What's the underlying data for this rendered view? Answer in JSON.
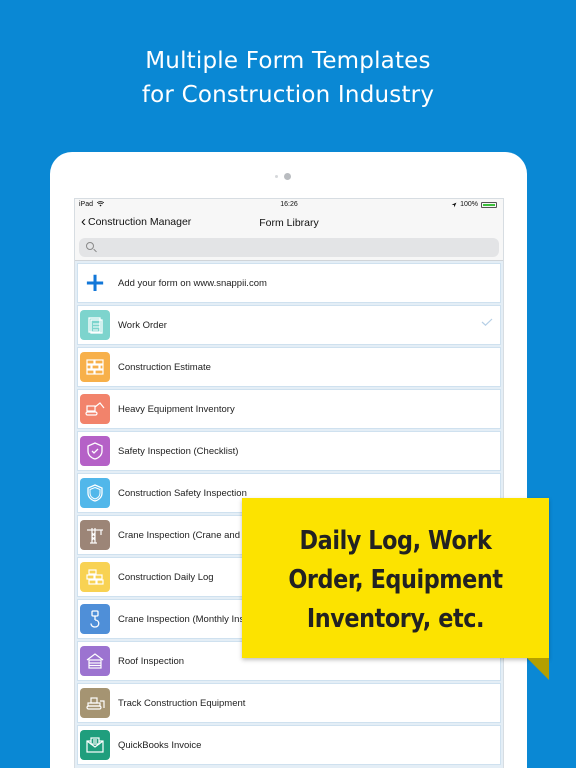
{
  "headline": {
    "line1": "Multiple Form Templates",
    "line2": "for Construction Industry"
  },
  "statusbar": {
    "device": "iPad",
    "time": "16:26",
    "battery": "100%"
  },
  "navbar": {
    "back_label": "Construction Manager",
    "title": "Form Library"
  },
  "search": {
    "placeholder": ""
  },
  "rows": [
    {
      "label": "Add your form on www.snappii.com",
      "icon": "plus-icon",
      "color": "#ffffff"
    },
    {
      "label": "Work Order",
      "icon": "clipboard-icon",
      "color": "#7dd4cd",
      "checked": true
    },
    {
      "label": "Construction Estimate",
      "icon": "bricks-icon",
      "color": "#f7b04a"
    },
    {
      "label": "Heavy Equipment Inventory",
      "icon": "excavator-icon",
      "color": "#f2836b"
    },
    {
      "label": "Safety Inspection (Checklist)",
      "icon": "shield-check-icon",
      "color": "#b561c7"
    },
    {
      "label": "Construction Safety Inspection",
      "icon": "shield-icon",
      "color": "#51b7ea"
    },
    {
      "label": "Crane Inspection (Crane and E",
      "icon": "crane-icon",
      "color": "#9c8577"
    },
    {
      "label": "Construction Daily Log",
      "icon": "bricks-icon",
      "color": "#f8d253"
    },
    {
      "label": "Crane Inspection (Monthly Ins",
      "icon": "hook-icon",
      "color": "#4f8fd8"
    },
    {
      "label": "Roof Inspection",
      "icon": "roof-icon",
      "color": "#9c73d0"
    },
    {
      "label": "Track Construction Equipment",
      "icon": "bulldozer-icon",
      "color": "#a59472"
    },
    {
      "label": "QuickBooks Invoice",
      "icon": "envelope-icon",
      "color": "#1f9e7d"
    }
  ],
  "overlay": {
    "line1": "Daily Log, Work",
    "line2": "Order, Equipment",
    "line3": "Inventory, etc."
  }
}
